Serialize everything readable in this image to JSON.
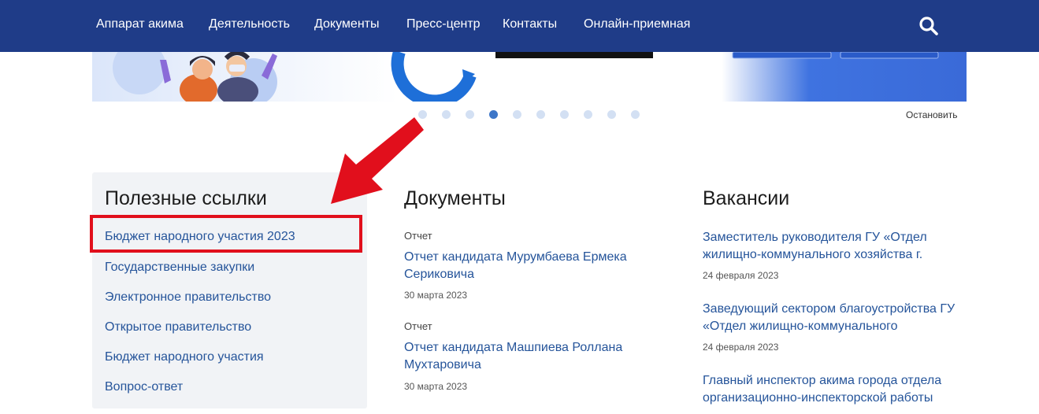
{
  "nav": {
    "items": [
      "Аппарат акима",
      "Деятельность",
      "Документы",
      "Пресс-центр",
      "Контакты",
      "Онлайн-приемная"
    ],
    "search_icon": "search-icon"
  },
  "carousel": {
    "dot_count": 10,
    "active_index": 3,
    "stop_label": "Остановить"
  },
  "useful_links": {
    "title": "Полезные ссылки",
    "items": [
      "Бюджет народного участия 2023",
      "Государственные закупки",
      "Электронное правительство",
      "Открытое правительство",
      "Бюджет народного участия",
      "Вопрос-ответ"
    ]
  },
  "documents": {
    "title": "Документы",
    "items": [
      {
        "type": "Отчет",
        "title": "Отчет кандидата Мурумбаева Ермека Сериковича",
        "date": "30 марта 2023"
      },
      {
        "type": "Отчет",
        "title": "Отчет кандидата Машпиева Роллана Мухтаровича",
        "date": "30 марта 2023"
      }
    ]
  },
  "vacancies": {
    "title": "Вакансии",
    "items": [
      {
        "title": "Заместитель руководителя ГУ «Отдел жилищно-коммунального хозяйства г.",
        "date": "24 февраля 2023"
      },
      {
        "title": "Заведующий сектором благоустройства ГУ «Отдел жилищно-коммунального",
        "date": "24 февраля 2023"
      },
      {
        "title": "Главный инспектор акима города отдела организационно-инспекторской работы",
        "date": ""
      }
    ]
  },
  "colors": {
    "nav_bg": "#1f3c88",
    "link": "#25549a",
    "highlight": "#e10f1c",
    "panel_bg": "#f1f3f6"
  }
}
